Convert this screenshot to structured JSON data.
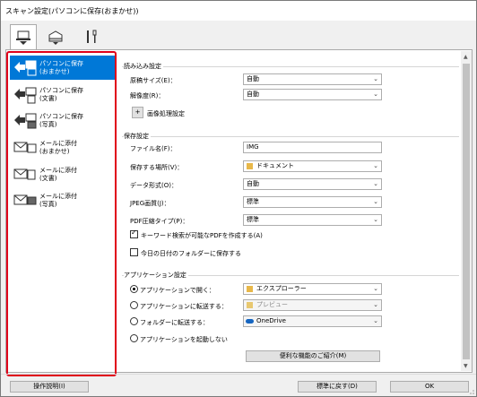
{
  "window": {
    "title": "スキャン設定(パソコンに保存(おまかせ))"
  },
  "icon_tabs": [
    {
      "icon": "scan-from-computer-icon"
    },
    {
      "icon": "scan-from-operation-panel-icon"
    },
    {
      "icon": "general-settings-icon"
    }
  ],
  "sidebar": {
    "items": [
      {
        "line1": "パソコンに保存",
        "line2": "(おまかせ)",
        "icon": "save-to-pc-auto-icon",
        "selected": true
      },
      {
        "line1": "パソコンに保存",
        "line2": "(文書)",
        "icon": "save-to-pc-document-icon",
        "selected": false
      },
      {
        "line1": "パソコンに保存",
        "line2": "(写真)",
        "icon": "save-to-pc-photo-icon",
        "selected": false
      },
      {
        "line1": "メールに添付",
        "line2": "(おまかせ)",
        "icon": "attach-email-auto-icon",
        "selected": false
      },
      {
        "line1": "メールに添付",
        "line2": "(文書)",
        "icon": "attach-email-document-icon",
        "selected": false
      },
      {
        "line1": "メールに添付",
        "line2": "(写真)",
        "icon": "attach-email-photo-icon",
        "selected": false
      }
    ]
  },
  "scan_options": {
    "title": "読み込み設定",
    "paper_size_label": "原稿サイズ(E)：",
    "paper_size_value": "自動",
    "resolution_label": "解像度(R)：",
    "resolution_value": "自動",
    "image_processing_label": "画像処理設定",
    "expand_symbol": "+"
  },
  "save_settings": {
    "title": "保存設定",
    "file_name_label": "ファイル名(F)：",
    "file_name_value": "IMG",
    "save_in_label": "保存する場所(V)：",
    "save_in_value": "ドキュメント",
    "data_format_label": "データ形式(O)：",
    "data_format_value": "自動",
    "jpeg_quality_label": "JPEG画質(J)：",
    "jpeg_quality_value": "標準",
    "pdf_compression_label": "PDF圧縮タイプ(P)：",
    "pdf_compression_value": "標準",
    "keyword_pdf_label": "キーワード検索が可能なPDFを作成する(A)",
    "keyword_pdf_checked": true,
    "date_folder_label": "今日の日付のフォルダーに保存する",
    "date_folder_checked": false
  },
  "app_settings": {
    "title": "アプリケーション設定",
    "open_with_label": "アプリケーションで開く：",
    "open_with_value": "エクスプローラー",
    "send_to_app_label": "アプリケーションに転送する：",
    "send_to_app_value": "プレビュー",
    "send_to_folder_label": "フォルダーに転送する：",
    "send_to_folder_value": "OneDrive",
    "do_not_start_label": "アプリケーションを起動しない",
    "more_functions_label": "便利な機能のご紹介(M)",
    "selected_option": "open_with"
  },
  "footer": {
    "instructions_label": "操作説明(I)",
    "defaults_label": "標準に戻す(D)",
    "ok_label": "OK"
  },
  "colors": {
    "highlight": "#0078d7",
    "red_outline": "#e0001a"
  }
}
